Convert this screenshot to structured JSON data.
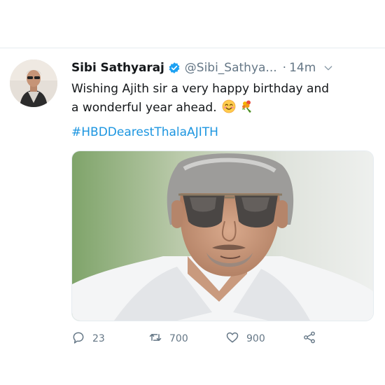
{
  "tweet": {
    "display_name": "Sibi Sathyaraj",
    "handle": "@Sibi_Sathya...",
    "separator": "·",
    "time": "14m",
    "text_line1": "Wishing Ajith sir a very happy birthday and",
    "text_line2": "a wonderful year ahead.",
    "hashtag": "#HBDDearestThalaAJITH",
    "reply_count": "23",
    "retweet_count": "700",
    "like_count": "900"
  },
  "colors": {
    "link": "#1b95e0",
    "verified": "#1da1f2",
    "secondary_text": "#657786"
  },
  "icons": {
    "verified": "verified-badge-icon",
    "caret": "chevron-down-icon",
    "emoji1": "smiling-face-emoji",
    "emoji2": "bouquet-emoji",
    "reply": "reply-icon",
    "retweet": "retweet-icon",
    "like": "heart-icon",
    "share": "share-icon"
  }
}
